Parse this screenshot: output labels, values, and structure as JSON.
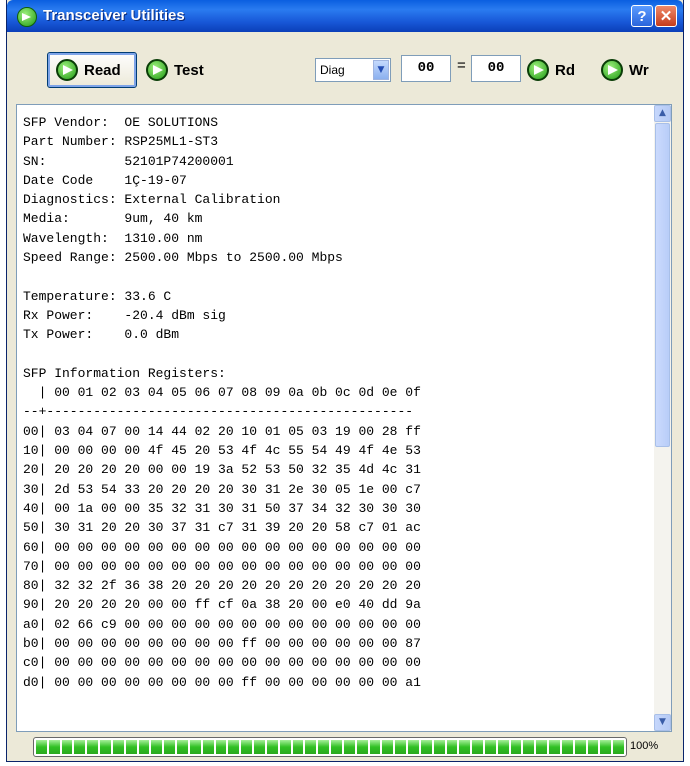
{
  "window": {
    "title": "Transceiver Utilities"
  },
  "toolbar": {
    "read_label": "Read",
    "test_label": "Test",
    "mode_select": "Diag",
    "address": "00",
    "equals": "=",
    "value": "00",
    "rd_label": "Rd",
    "wr_label": "Wr"
  },
  "output": {
    "lines": [
      "SFP Vendor:  OE SOLUTIONS",
      "Part Number: RSP25ML1-ST3",
      "SN:          52101P74200001",
      "Date Code    1Ç-19-07",
      "Diagnostics: External Calibration",
      "Media:       9um, 40 km",
      "Wavelength:  1310.00 nm",
      "Speed Range: 2500.00 Mbps to 2500.00 Mbps",
      "",
      "Temperature: 33.6 C",
      "Rx Power:    -20.4 dBm sig",
      "Tx Power:    0.0 dBm",
      "",
      "SFP Information Registers:",
      "  | 00 01 02 03 04 05 06 07 08 09 0a 0b 0c 0d 0e 0f",
      "--+-----------------------------------------------",
      "00| 03 04 07 00 14 44 02 20 10 01 05 03 19 00 28 ff",
      "10| 00 00 00 00 4f 45 20 53 4f 4c 55 54 49 4f 4e 53",
      "20| 20 20 20 20 00 00 19 3a 52 53 50 32 35 4d 4c 31",
      "30| 2d 53 54 33 20 20 20 20 30 31 2e 30 05 1e 00 c7",
      "40| 00 1a 00 00 35 32 31 30 31 50 37 34 32 30 30 30",
      "50| 30 31 20 20 30 37 31 c7 31 39 20 20 58 c7 01 ac",
      "60| 00 00 00 00 00 00 00 00 00 00 00 00 00 00 00 00",
      "70| 00 00 00 00 00 00 00 00 00 00 00 00 00 00 00 00",
      "80| 32 32 2f 36 38 20 20 20 20 20 20 20 20 20 20 20",
      "90| 20 20 20 20 00 00 ff cf 0a 38 20 00 e0 40 dd 9a",
      "a0| 02 66 c9 00 00 00 00 00 00 00 00 00 00 00 00 00",
      "b0| 00 00 00 00 00 00 00 00 ff 00 00 00 00 00 00 87",
      "c0| 00 00 00 00 00 00 00 00 00 00 00 00 00 00 00 00",
      "d0| 00 00 00 00 00 00 00 00 ff 00 00 00 00 00 00 a1"
    ]
  },
  "progress": {
    "value": 1.0,
    "label": "100%"
  }
}
